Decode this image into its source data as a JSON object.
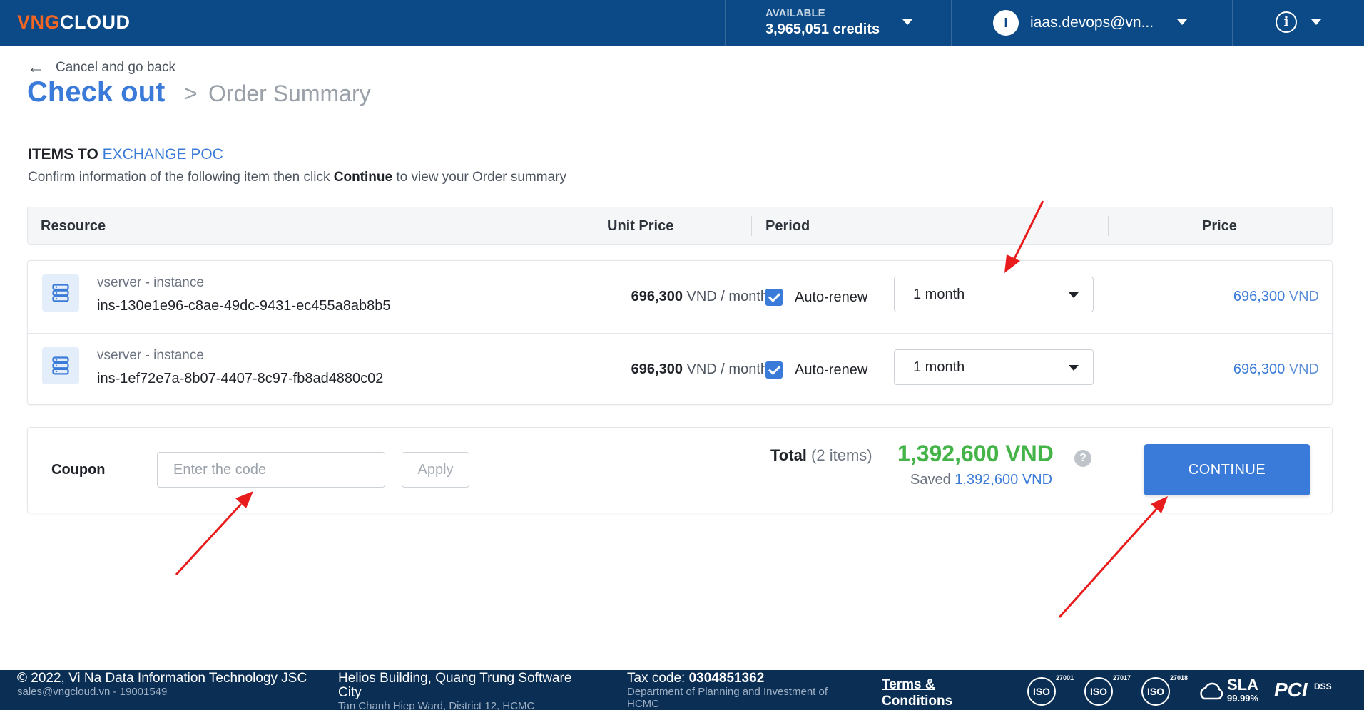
{
  "header": {
    "logo_vng": "VNG",
    "logo_cloud": "CLOUD",
    "credits_label": "AVAILABLE",
    "credits_value": "3,965,051 credits",
    "avatar_letter": "I",
    "account_email": "iaas.devops@vn...",
    "help_glyph": "i"
  },
  "breadcrumb": {
    "back_label": "Cancel and go back",
    "title": "Check out",
    "separator": ">",
    "subtitle": "Order Summary"
  },
  "section": {
    "title_prefix": "ITEMS TO",
    "project": "EXCHANGE POC",
    "desc_before": "Confirm information of the following item then click",
    "desc_bold": "Continue",
    "desc_after": "to view your Order summary"
  },
  "table": {
    "headers": {
      "resource": "Resource",
      "unit_price": "Unit Price",
      "period": "Period",
      "price": "Price"
    },
    "rows": [
      {
        "type": "vserver - instance",
        "id": "ins-130e1e96-c8ae-49dc-9431-ec455a8ab8b5",
        "unit_amount": "696,300",
        "unit_suffix": "VND / month",
        "auto_renew_label": "Auto-renew",
        "auto_renew": true,
        "period": "1 month",
        "price_amount": "696,300",
        "price_currency": "VND"
      },
      {
        "type": "vserver - instance",
        "id": "ins-1ef72e7a-8b07-4407-8c97-fb8ad4880c02",
        "unit_amount": "696,300",
        "unit_suffix": "VND / month",
        "auto_renew_label": "Auto-renew",
        "auto_renew": true,
        "period": "1 month",
        "price_amount": "696,300",
        "price_currency": "VND"
      }
    ]
  },
  "summary": {
    "coupon_label": "Coupon",
    "coupon_placeholder": "Enter the code",
    "apply_label": "Apply",
    "total_label": "Total",
    "total_count": "(2 items)",
    "total_value": "1,392,600 VND",
    "help_glyph": "?",
    "saved_label": "Saved",
    "saved_value": "1,392,600 VND",
    "continue_label": "CONTINUE"
  },
  "footer": {
    "copyright": "© 2022, Vi Na Data Information Technology JSC",
    "contact": "sales@vngcloud.vn - 19001549",
    "address_title": "Helios Building, Quang Trung Software City",
    "address_detail": "Tan Chanh Hiep Ward, District 12, HCMC",
    "tax_label": "Tax code:",
    "tax_code": "0304851362",
    "tax_authority": "Department of Planning and Investment of HCMC",
    "terms": "Terms & Conditions",
    "badges": {
      "iso1_text": "ISO",
      "iso1_num": "27001",
      "iso2_text": "ISO",
      "iso2_num": "27017",
      "iso3_text": "ISO",
      "iso3_num": "27018",
      "sla_label": "SLA",
      "sla_value": "99.99%",
      "pci_label": "PCI",
      "pci_suffix": "DSS"
    }
  },
  "colors": {
    "header_bg": "#0b4a86",
    "accent": "#3a7ad8",
    "total_green": "#44b449",
    "footer_bg": "#0b2e54",
    "annotation_arrow": "#e81c1c"
  }
}
